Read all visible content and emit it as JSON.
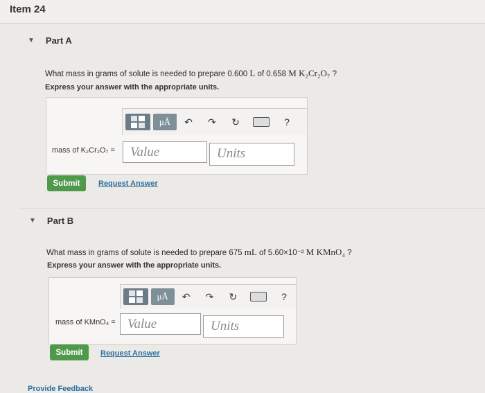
{
  "item": {
    "title": "Item 24"
  },
  "partA": {
    "title": "Part A",
    "question_pre": "What mass in grams of solute is needed to prepare 0.600",
    "question_unit": "L",
    "question_mid": "of 0.658",
    "question_formula": "M K₂Cr₂O₇",
    "question_end": "?",
    "instruction": "Express your answer with the appropriate units.",
    "field_label": "mass of K₂Cr₂O₇ =",
    "value_placeholder": "Value",
    "units_placeholder": "Units",
    "submit_label": "Submit",
    "request_label": "Request Answer"
  },
  "partB": {
    "title": "Part B",
    "question_pre": "What mass in grams of solute is needed to prepare 675",
    "question_unit": "mL",
    "question_mid": "of 5.60×10⁻²",
    "question_formula": "M KMnO₄",
    "question_end": "?",
    "instruction": "Express your answer with the appropriate units.",
    "field_label": "mass of KMnO₄ =",
    "value_placeholder": "Value",
    "units_placeholder": "Units",
    "submit_label": "Submit",
    "request_label": "Request Answer"
  },
  "toolbar": {
    "mu_label": "μÅ",
    "help_label": "?"
  },
  "footer": {
    "feedback_label": "Provide Feedback"
  }
}
